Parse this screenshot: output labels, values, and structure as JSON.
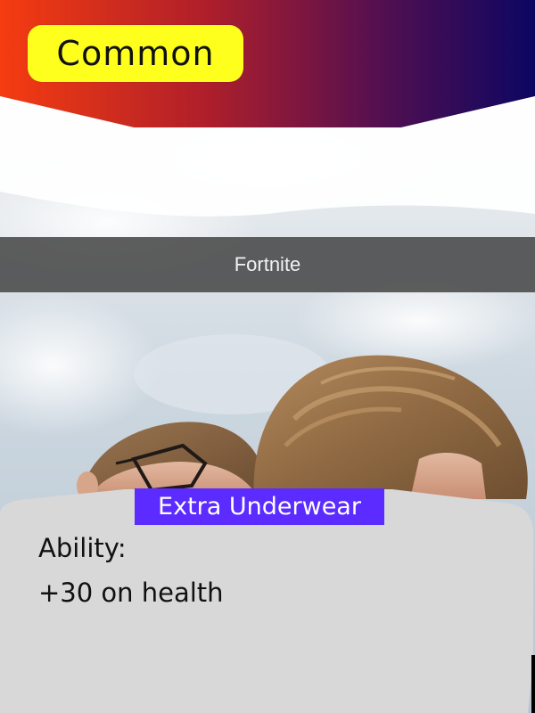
{
  "card": {
    "rarity": "Common",
    "game_title": "Fortnite",
    "name": "Extra Underwear",
    "ability_label": "Ability:",
    "ability_text": "+30 on health"
  },
  "colors": {
    "banner_left": "#f53c10",
    "banner_right": "#0c0662",
    "rarity_badge": "#ffff1e",
    "name_bg": "#5b2bff",
    "panel_bg": "#d8d8d8",
    "title_bar_bg": "#484848"
  }
}
